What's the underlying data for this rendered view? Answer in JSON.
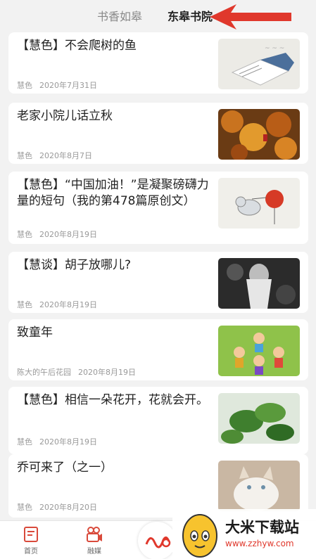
{
  "tabs": [
    {
      "label": "书香如皋"
    },
    {
      "label": "东皋书院"
    }
  ],
  "articles": [
    {
      "title": "【慧色】不会爬树的鱼",
      "author": "慧色",
      "date": "2020年7月31日"
    },
    {
      "title": "老家小院儿话立秋",
      "author": "慧色",
      "date": "2020年8月7日"
    },
    {
      "title": "【慧色】“中国加油！”是凝聚磅礴力量的短句（我的第478篇原创文）",
      "author": "慧色",
      "date": "2020年8月19日"
    },
    {
      "title": "【慧谈】胡子放哪儿?",
      "author": "慧色",
      "date": "2020年8月19日"
    },
    {
      "title": "致童年",
      "author": "陈大的午后花园",
      "date": "2020年8月19日"
    },
    {
      "title": "【慧色】相信一朵花开，花就会开。",
      "author": "慧色",
      "date": "2020年8月19日"
    },
    {
      "title": "乔可来了（之一）",
      "author": "慧色",
      "date": "2020年8月20日"
    }
  ],
  "bottom_nav": [
    {
      "label": "首页",
      "icon": "home-book-icon"
    },
    {
      "label": "融媒",
      "icon": "video-camera-icon"
    }
  ],
  "watermark": {
    "title": "大米下载站",
    "url": "www.zzhyw.com"
  },
  "colors": {
    "accent_red": "#e0382c",
    "background": "#f2f2f2"
  }
}
